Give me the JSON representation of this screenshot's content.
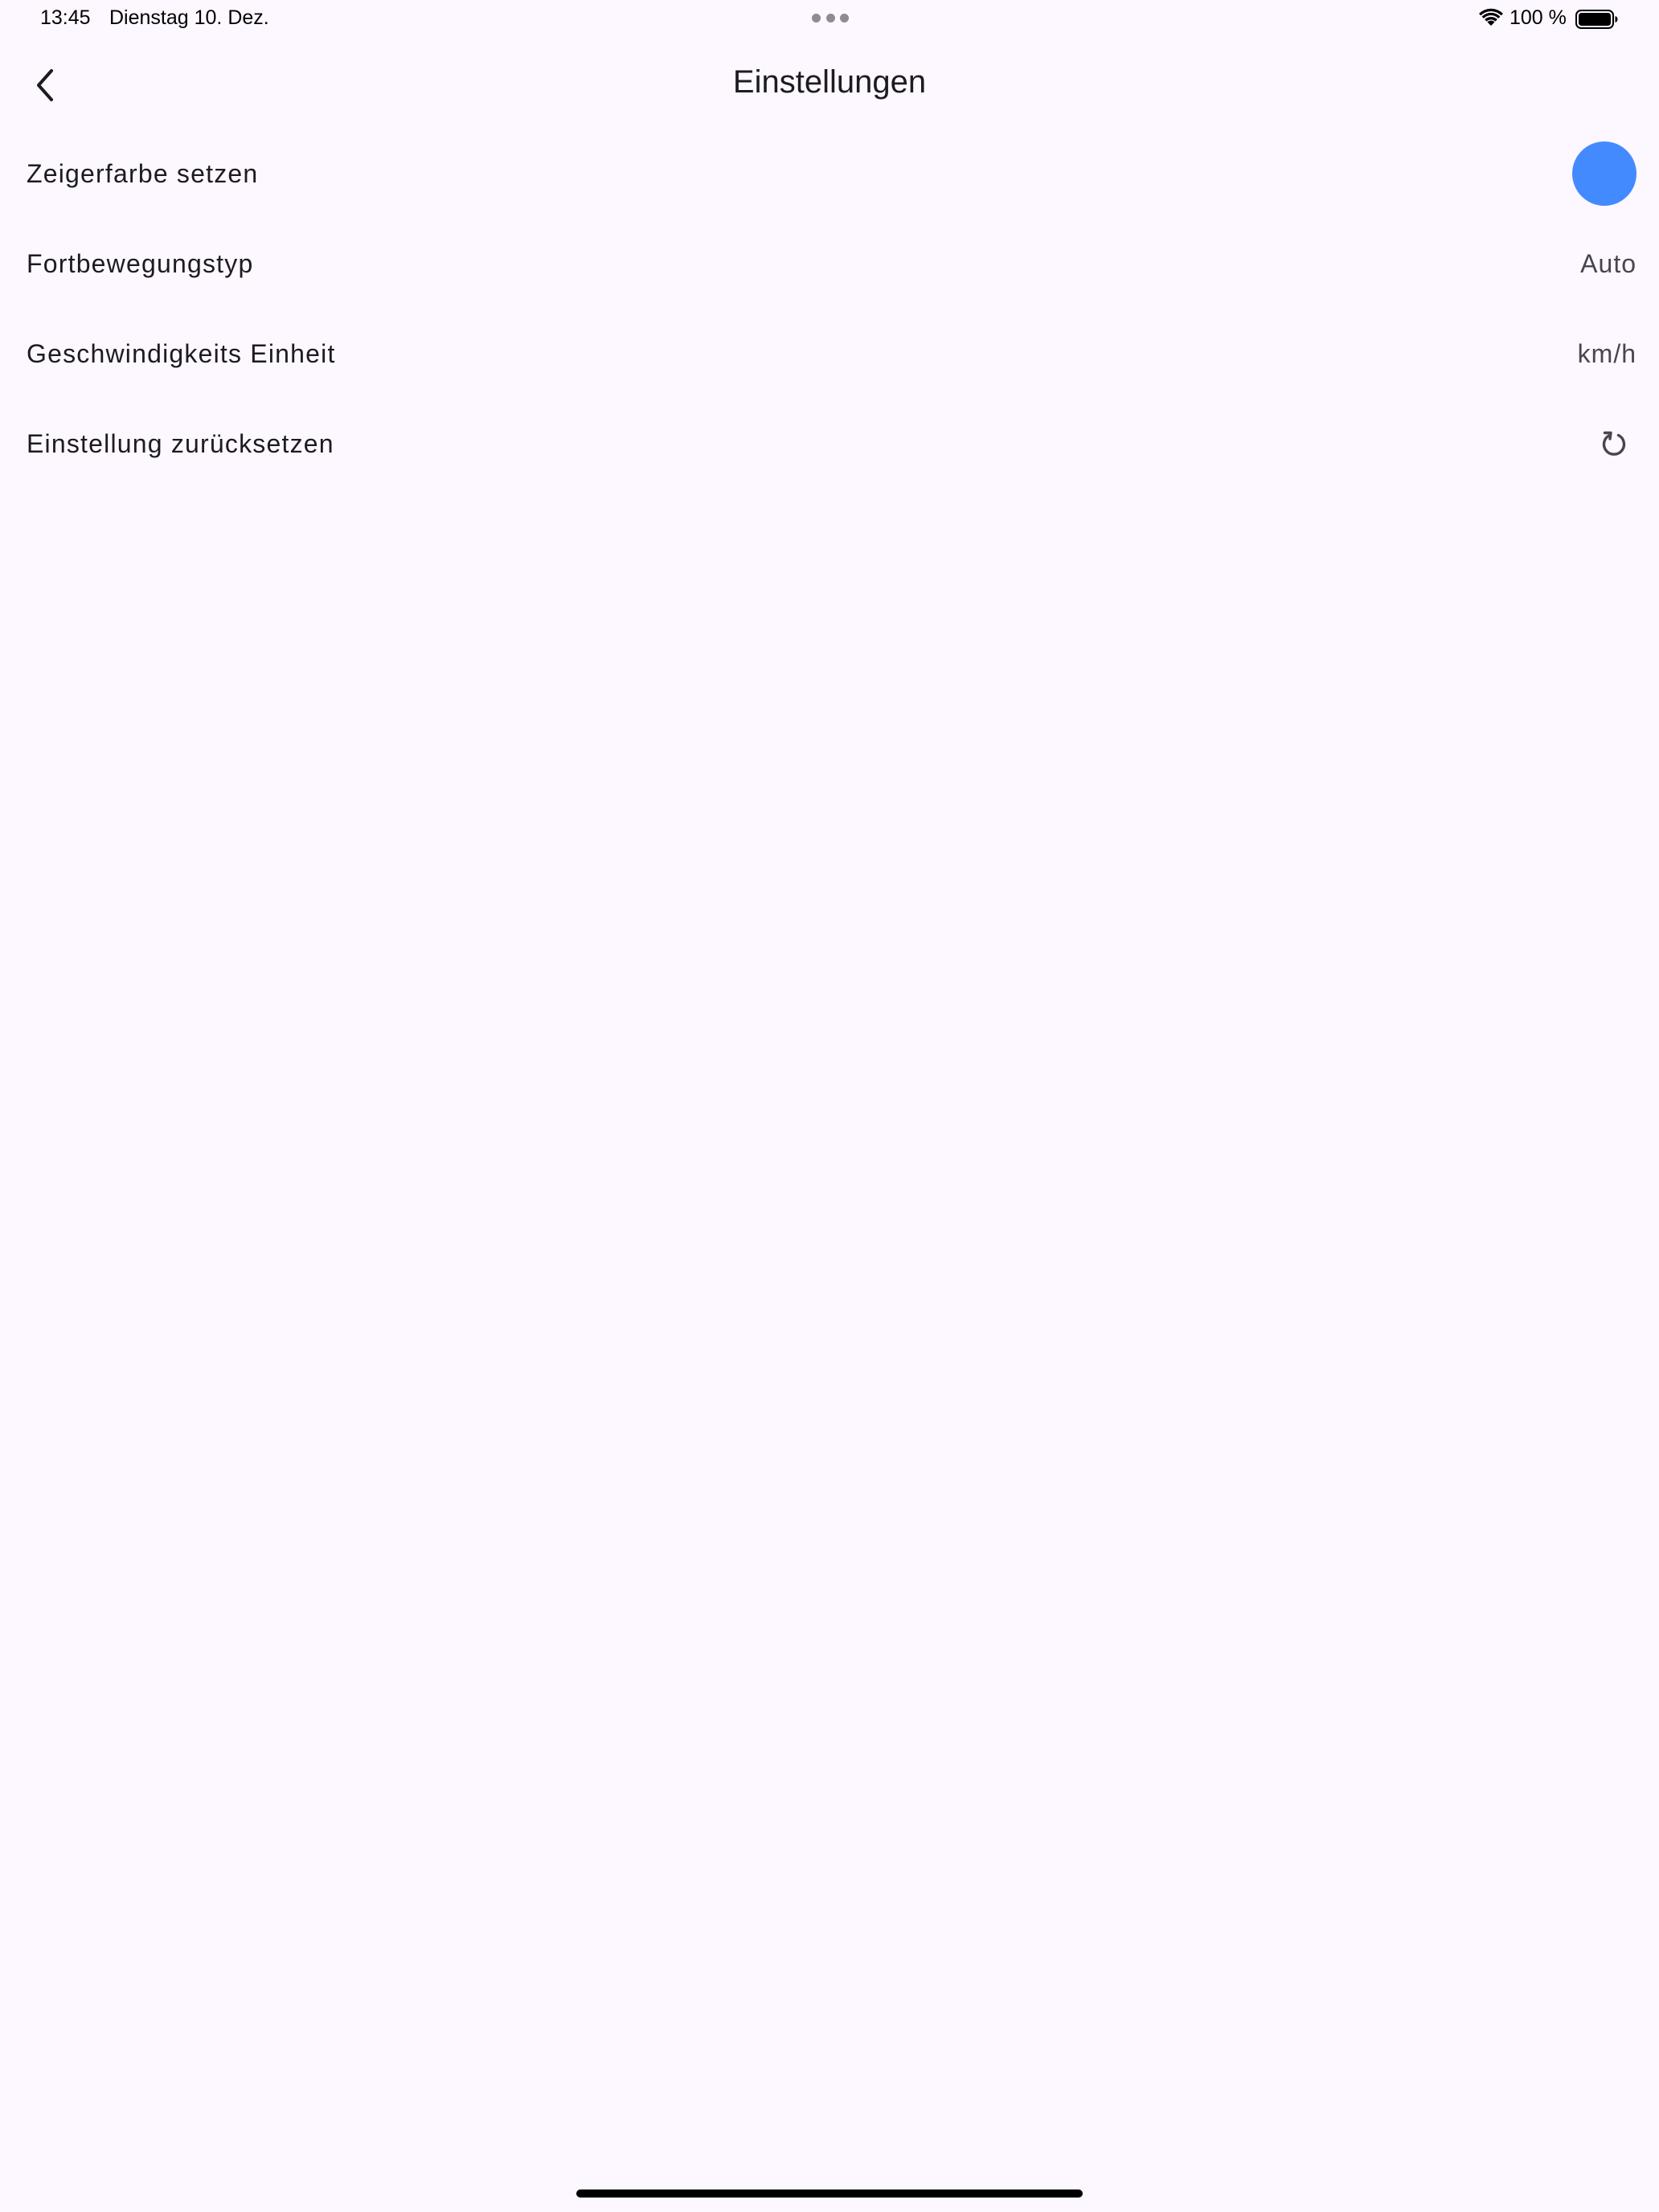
{
  "status_bar": {
    "time": "13:45",
    "date": "Dienstag 10. Dez.",
    "battery": "100 %"
  },
  "app_bar": {
    "title": "Einstellungen",
    "back_icon": "chevron-left-icon"
  },
  "settings": {
    "items": [
      {
        "label": "Zeigerfarbe setzen",
        "swatch_color": "#448aff"
      },
      {
        "label": "Fortbewegungstyp",
        "value": "Auto"
      },
      {
        "label": "Geschwindigkeits Einheit",
        "value": "km/h"
      },
      {
        "label": "Einstellung zurücksetzen",
        "icon": "reset-icon"
      }
    ]
  },
  "colors": {
    "background": "#fdf7ff",
    "accent": "#448aff"
  }
}
